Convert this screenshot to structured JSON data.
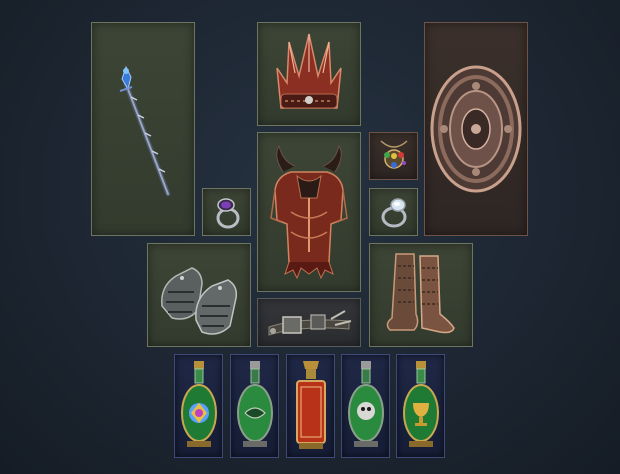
{
  "equipment": {
    "weapon": {
      "icon": "staff-icon",
      "rarity": "magic"
    },
    "helmet": {
      "icon": "crown-helmet-icon",
      "rarity": "magic"
    },
    "offhand": {
      "icon": "round-shield-icon",
      "rarity": "unique"
    },
    "ring_left": {
      "icon": "amethyst-ring-icon",
      "rarity": "magic"
    },
    "body_armour": {
      "icon": "horned-chest-armour-icon",
      "rarity": "magic"
    },
    "amulet": {
      "icon": "gem-amulet-icon",
      "rarity": "unique"
    },
    "ring_right": {
      "icon": "moonstone-ring-icon",
      "rarity": "magic"
    },
    "gloves": {
      "icon": "plate-gauntlets-icon",
      "rarity": "magic"
    },
    "belt": {
      "icon": "buckled-belt-icon",
      "rarity": "normal"
    },
    "boots": {
      "icon": "scaled-boots-icon",
      "rarity": "magic"
    }
  },
  "flasks": [
    {
      "icon": "rainbow-gem-flask-icon",
      "liquid": "#2e9a46"
    },
    {
      "icon": "swirl-flask-icon",
      "liquid": "#2f8a3e"
    },
    {
      "icon": "red-bottle-flask-icon",
      "liquid": "#c23b1c"
    },
    {
      "icon": "skull-orb-flask-icon",
      "liquid": "#2f8a3e"
    },
    {
      "icon": "golden-chalice-flask-icon",
      "liquid": "#2e9a46"
    }
  ],
  "colors": {
    "background": "#1d2632",
    "slot_magic": "#3b4334",
    "slot_unique": "#35302d",
    "flask_frame": "#1f2846"
  }
}
